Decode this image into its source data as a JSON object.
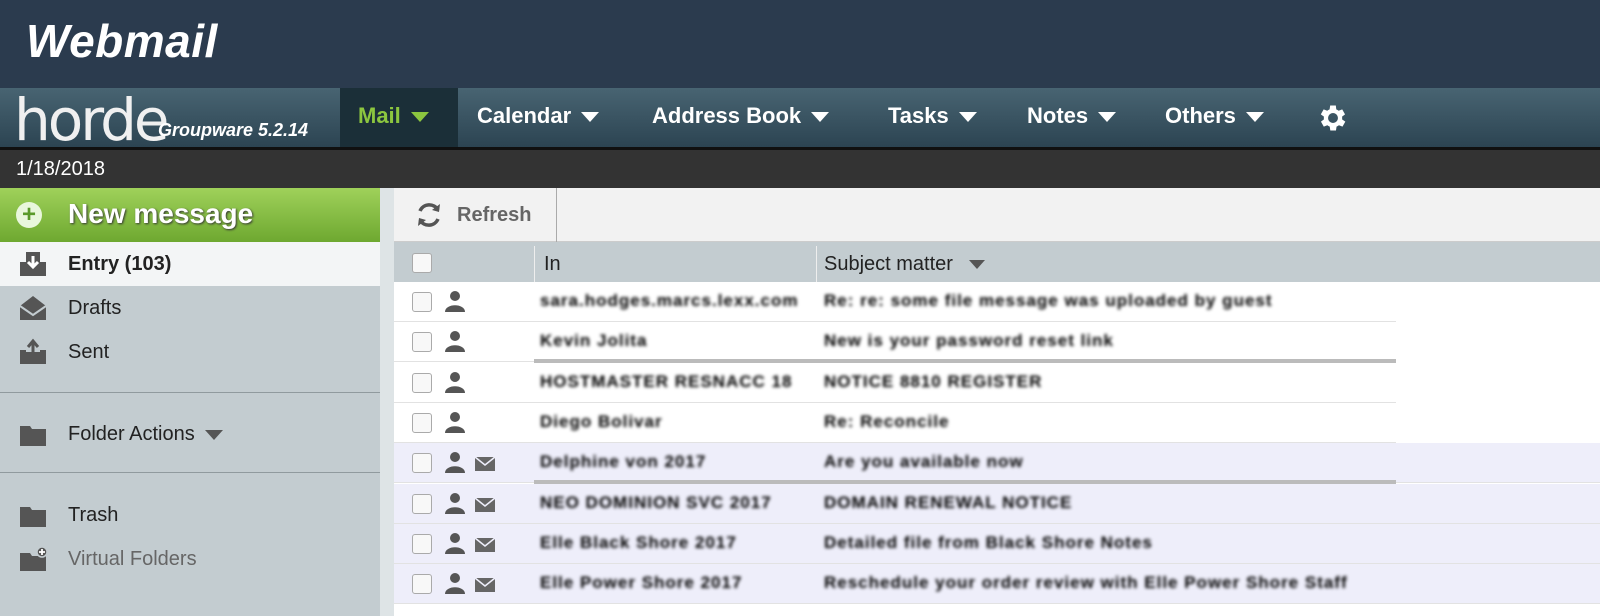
{
  "header": {
    "app_title": "Webmail"
  },
  "branding": {
    "logo_word": "horde",
    "version": "Groupware 5.2.14"
  },
  "nav": {
    "items": [
      {
        "label": "Mail",
        "active": true
      },
      {
        "label": "Calendar"
      },
      {
        "label": "Address Book"
      },
      {
        "label": "Tasks"
      },
      {
        "label": "Notes"
      },
      {
        "label": "Others"
      }
    ],
    "settings_icon": "gear-icon"
  },
  "date": "1/18/2018",
  "sidebar": {
    "new_message": "New message",
    "folders": [
      {
        "label": "Entry (103)",
        "icon": "inbox-icon"
      },
      {
        "label": "Drafts",
        "icon": "drafts-icon"
      },
      {
        "label": "Sent",
        "icon": "sent-icon"
      }
    ],
    "folder_actions": "Folder Actions",
    "trash": "Trash",
    "virtual_folders": "Virtual Folders"
  },
  "toolbar": {
    "refresh": "Refresh"
  },
  "table": {
    "columns": {
      "from": "In",
      "subject": "Subject matter"
    },
    "rows": [
      {
        "from": "sara.hodges.marcs.lexx.com",
        "subject": "Re: re: some file message was uploaded by guest",
        "unread": false,
        "envelope": false
      },
      {
        "from": "Kevin Jolita",
        "subject": "New is your password reset link",
        "unread": false,
        "envelope": false
      },
      {
        "from": "HOSTMASTER RESNACC 18",
        "subject": "NOTICE 8810 REGISTER",
        "unread": false,
        "envelope": false
      },
      {
        "from": "Diego Bolivar",
        "subject": "Re: Reconcile",
        "unread": false,
        "envelope": false
      },
      {
        "from": "Delphine von 2017",
        "subject": "Are you available now",
        "unread": true,
        "envelope": true
      },
      {
        "from": "NEO DOMINION SVC 2017",
        "subject": "DOMAIN RENEWAL NOTICE",
        "unread": true,
        "envelope": true
      },
      {
        "from": "Elle Black Shore 2017",
        "subject": "Detailed file from Black Shore Notes",
        "unread": true,
        "envelope": true
      },
      {
        "from": "Elle Power Shore 2017",
        "subject": "Reschedule your order review with Elle Power Shore Staff",
        "unread": true,
        "envelope": true
      }
    ]
  }
}
